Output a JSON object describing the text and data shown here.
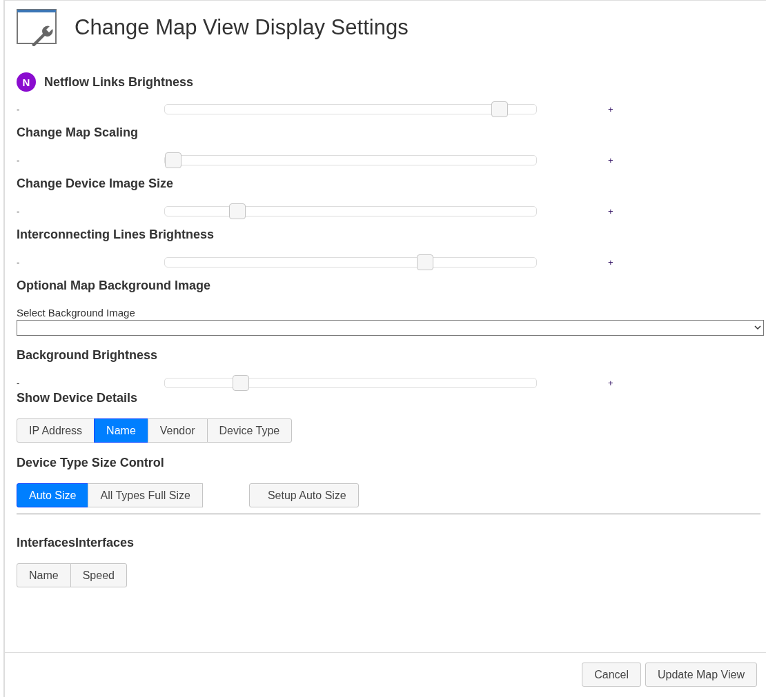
{
  "title": "Change Map View Display Settings",
  "sections": [
    {
      "kind": "slider",
      "title": "Netflow Links Brightness",
      "badge": "N",
      "minus": "-",
      "plus": "+",
      "level": 0.92
    },
    {
      "kind": "slider",
      "title": "Change Map Scaling",
      "minus": "-",
      "plus": "+",
      "level": 0.0
    },
    {
      "kind": "slider",
      "title": "Change Device Image Size",
      "minus": "-",
      "plus": "+",
      "level": 0.18
    },
    {
      "kind": "slider",
      "title": "Interconnecting Lines Brightness",
      "minus": "-",
      "plus": "+",
      "level": 0.71
    },
    {
      "kind": "select",
      "title": "Optional Map Background Image",
      "label": "Select Background Image"
    },
    {
      "kind": "slider",
      "title": "Background Brightness",
      "minus": "-",
      "plus": "+",
      "level": 0.19
    },
    {
      "kind": "segmented",
      "title": "Show Device Details",
      "options": [
        {
          "label": "IP Address",
          "selected": false
        },
        {
          "label": "Name",
          "selected": true
        },
        {
          "label": "Vendor",
          "selected": false
        },
        {
          "label": "Device Type",
          "selected": false
        }
      ]
    },
    {
      "kind": "segmented",
      "title": "Device Type Size Control",
      "options": [
        {
          "label": "Auto Size",
          "selected": true
        },
        {
          "label": "All Types Full Size",
          "selected": false
        }
      ],
      "extra_button": "Setup Auto Size",
      "divider": true
    },
    {
      "kind": "segmented",
      "title": "InterfacesInterfaces",
      "options": [
        {
          "label": "Name",
          "selected": false
        },
        {
          "label": "Speed",
          "selected": false
        }
      ]
    }
  ],
  "buttons": [
    "Cancel",
    "Update Map View"
  ]
}
